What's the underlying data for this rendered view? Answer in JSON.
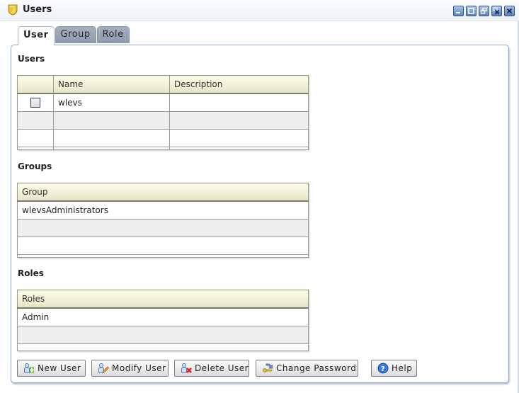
{
  "window": {
    "title": "Users",
    "controls": [
      "minimize",
      "maximize",
      "restore",
      "close-all",
      "close"
    ]
  },
  "tabs": [
    {
      "label": "User",
      "active": true
    },
    {
      "label": "Group",
      "active": false
    },
    {
      "label": "Role",
      "active": false
    }
  ],
  "users_section": {
    "label": "Users",
    "columns": [
      "",
      "Name",
      "Description"
    ],
    "rows": [
      {
        "checked": false,
        "name": "wlevs",
        "description": ""
      },
      {
        "checked": null,
        "name": "",
        "description": ""
      },
      {
        "checked": null,
        "name": "",
        "description": ""
      }
    ]
  },
  "groups_section": {
    "label": "Groups",
    "columns": [
      "Group"
    ],
    "rows": [
      "wlevsAdministrators",
      "",
      ""
    ]
  },
  "roles_section": {
    "label": "Roles",
    "columns": [
      "Roles"
    ],
    "rows": [
      "Admin",
      ""
    ]
  },
  "buttons": {
    "new_user": "New User",
    "modify_user": "Modify User",
    "delete_user": "Delete User",
    "change_password": "Change Password",
    "help": "Help"
  },
  "colors": {
    "title_icon": "#e8c63a",
    "window_button": "#5a82bf",
    "tab_inactive": "#9aa6b8",
    "table_header": "#eeedd4",
    "alt_row": "#eeeeee",
    "panel_border": "#93a6c4"
  }
}
